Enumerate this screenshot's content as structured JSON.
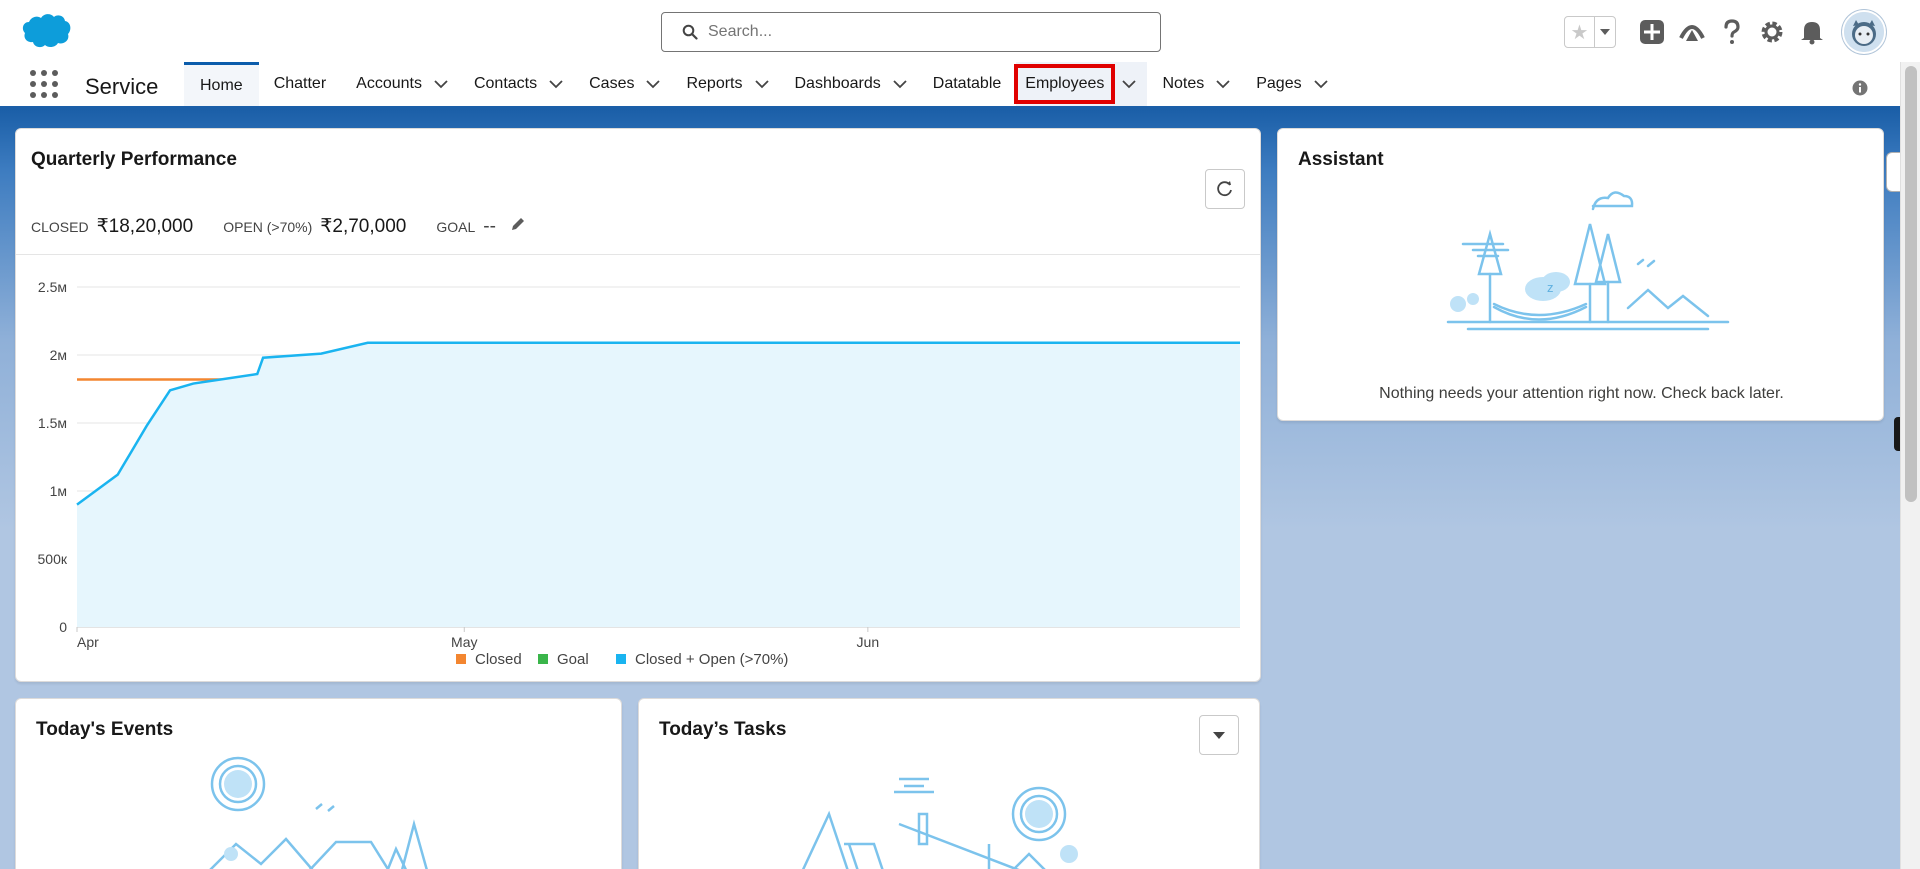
{
  "header": {
    "search_placeholder": "Search...",
    "icons": [
      "salesforce-cloud-logo",
      "favorites-star-icon",
      "chevron-down-icon",
      "add-icon",
      "trailhead-icon",
      "help-icon",
      "setup-gear-icon",
      "notifications-bell-icon",
      "user-avatar"
    ]
  },
  "nav": {
    "app_name": "Service",
    "items": [
      {
        "label": "Home",
        "dropdown": false,
        "active": true
      },
      {
        "label": "Chatter",
        "dropdown": false
      },
      {
        "label": "Accounts",
        "dropdown": true
      },
      {
        "label": "Contacts",
        "dropdown": true
      },
      {
        "label": "Cases",
        "dropdown": true
      },
      {
        "label": "Reports",
        "dropdown": true
      },
      {
        "label": "Dashboards",
        "dropdown": true
      },
      {
        "label": "Datatable",
        "dropdown": false
      },
      {
        "label": "Employees",
        "dropdown": true,
        "highlighted": true
      },
      {
        "label": "Notes",
        "dropdown": true
      },
      {
        "label": "Pages",
        "dropdown": true
      }
    ]
  },
  "quarterly": {
    "title": "Quarterly Performance",
    "closed_label": "CLOSED",
    "closed_value": "₹18,20,000",
    "open_label": "OPEN (>70%)",
    "open_value": "₹2,70,000",
    "goal_label": "GOAL",
    "goal_value": "--"
  },
  "chart_data": {
    "type": "area",
    "x_ticks": [
      "Apr",
      "May",
      "Jun"
    ],
    "y_ticks": [
      "0",
      "500к",
      "1м",
      "1.5м",
      "2м",
      "2.5м"
    ],
    "ylim": [
      0,
      2500000
    ],
    "series": [
      {
        "name": "Closed",
        "color": "#f38630",
        "type": "line",
        "x": [
          0,
          1
        ],
        "y": [
          1820000,
          1820000
        ]
      },
      {
        "name": "Goal",
        "color": "#3ab54a",
        "type": "line",
        "x": [],
        "y": []
      },
      {
        "name": "Closed + Open (>70%)",
        "color": "#1ab4f0",
        "type": "area",
        "x": [
          0,
          0.035,
          0.06,
          0.08,
          0.1,
          0.155,
          0.16,
          0.21,
          0.25,
          1
        ],
        "y": [
          900000,
          1120000,
          1480000,
          1740000,
          1790000,
          1860000,
          1980000,
          2010000,
          2090000,
          2090000
        ]
      }
    ],
    "legend_position": "bottom-center",
    "grid": true
  },
  "assistant": {
    "title": "Assistant",
    "message": "Nothing needs your attention right now. Check back later."
  },
  "events": {
    "title": "Today's Events"
  },
  "tasks": {
    "title": "Today’s Tasks"
  }
}
